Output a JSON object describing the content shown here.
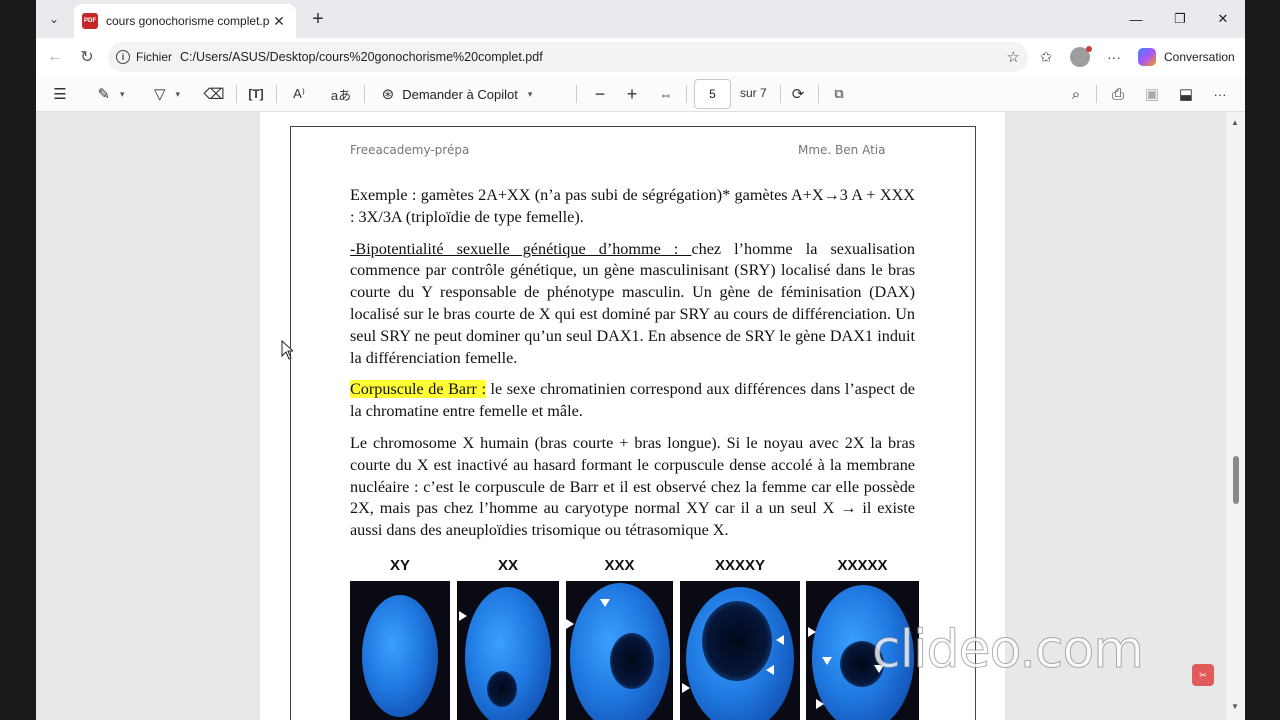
{
  "tab": {
    "title": "cours gonochorisme complet.pdf",
    "close": "✕",
    "new": "+"
  },
  "window": {
    "minimize": "—",
    "restore": "❐",
    "close": "✕"
  },
  "address": {
    "scheme": "Fichier",
    "url": "C:/Users/ASUS/Desktop/cours%20gonochorisme%20complet.pdf"
  },
  "copilot": {
    "label": "Conversation"
  },
  "pdf_toolbar": {
    "ask_copilot": "Demander à Copilot",
    "page_current": "5",
    "page_total": "sur 7"
  },
  "document": {
    "header_left": "Freeacademy-prépa",
    "header_right": "Mme. Ben Atia",
    "p1": "Exemple : gamètes 2A+XX (n’a pas subi de ségrégation)* gamètes A+X→3 A + XXX : 3X/3A (triploïdie de type femelle).",
    "p2_title": "-Bipotentialité sexuelle génétique d’homme : ",
    "p2_text": "chez l’homme la sexualisation commence par contrôle génétique, un gène masculinisant (SRY) localisé dans le bras courte du Y responsable de phénotype masculin. Un gène de féminisation (DAX) localisé sur le bras courte de X qui est dominé par SRY au cours de différenciation. Un seul SRY ne peut dominer qu’un seul DAX1. En absence de SRY le gène DAX1 induit la différenciation femelle.",
    "p3_title": "Corpuscule de Barr :",
    "p3_text": " le sexe chromatinien correspond aux différences dans l’aspect de la chromatine entre femelle et mâle.",
    "p4": "Le chromosome X humain (bras courte + bras longue). Si le noyau avec 2X la bras courte du X est inactivé au hasard formant le corpuscule dense accolé à la membrane nucléaire : c’est le corpuscule de Barr et il est observé chez la femme car elle possède 2X, mais pas chez l’homme au caryotype normal XY car il a un seul X → il existe aussi dans des aneuploïdies trisomique ou tétrasomique X.",
    "karyotypes": [
      "XY",
      "XX",
      "XXX",
      "XXXXY",
      "XXXXX"
    ]
  },
  "watermark": {
    "text": "clideo.com"
  }
}
